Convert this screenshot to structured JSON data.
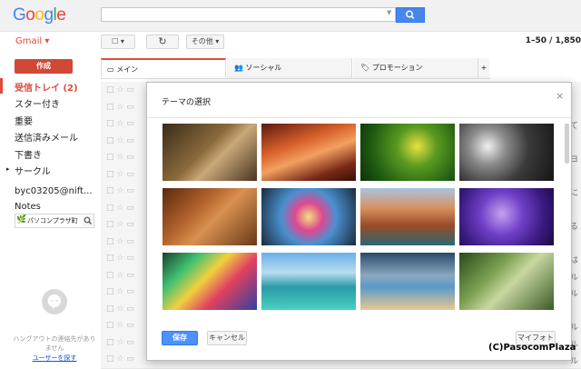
{
  "header": {
    "logo_letters": [
      {
        "ch": "G",
        "color": "#4285f4"
      },
      {
        "ch": "o",
        "color": "#ea4335"
      },
      {
        "ch": "o",
        "color": "#fbbc05"
      },
      {
        "ch": "g",
        "color": "#4285f4"
      },
      {
        "ch": "l",
        "color": "#34a853"
      },
      {
        "ch": "e",
        "color": "#ea4335"
      }
    ],
    "search_placeholder": "",
    "search_icon": "search-icon"
  },
  "toolbar": {
    "gmail_label": "Gmail",
    "select_label": "☐ ▾",
    "refresh_icon": "↻",
    "more_label": "その他 ▾",
    "pagination": "1–50 / 1,850"
  },
  "sidebar": {
    "compose_label": "作成",
    "items": [
      {
        "label": "受信トレイ (2)",
        "active": true
      },
      {
        "label": "スター付き"
      },
      {
        "label": "重要"
      },
      {
        "label": "送信済みメール"
      },
      {
        "label": "下書き"
      },
      {
        "label": "サークル"
      },
      {
        "label": "byc03205@nift..."
      },
      {
        "label": "Notes"
      }
    ],
    "chat_name": "パソコンプラザ町",
    "hangout_text": "ハングアウトの連絡先がありません",
    "hangout_link": "ユーザーを探す"
  },
  "mail_tabs": [
    {
      "label": "メイン",
      "icon": "inbox-icon"
    },
    {
      "label": "ソーシャル",
      "icon": "people-icon"
    },
    {
      "label": "プロモーション",
      "icon": "tag-icon"
    },
    {
      "label": "+"
    }
  ],
  "right_chars": [
    "",
    "",
    "て",
    "",
    "ヨ",
    "",
    "に",
    "",
    "る",
    "",
    "は",
    "ル",
    "ル",
    "",
    "ル",
    "ル",
    "ル"
  ],
  "modal": {
    "title": "テーマの選択",
    "close_label": "×",
    "save_label": "保存",
    "cancel_label": "キャンセル",
    "myphoto_label": "マイフォト",
    "themes": [
      {
        "name": "chess-theme-thumbnail",
        "gradient": "linear-gradient(135deg,#3a2a1a 0%,#8a6a3a 45%,#c9a87a 60%,#4a3420 100%)"
      },
      {
        "name": "canyon-theme-thumbnail",
        "gradient": "linear-gradient(160deg,#5a1a10 0%,#d8602a 35%,#f2a060 55%,#7a2a18 80%,#3a0e08 100%)"
      },
      {
        "name": "caterpillar-theme-thumbnail",
        "gradient": "radial-gradient(circle at 60% 40%,#e8e040 0%,#5a9a20 30%,#1e5a10 70%,#0e3008 100%)"
      },
      {
        "name": "pipes-theme-thumbnail",
        "gradient": "radial-gradient(circle at 30% 40%,#f0f0f0 0%,#8a8a8a 25%,#3a3a3a 55%,#151515 100%)"
      },
      {
        "name": "leaves-theme-thumbnail",
        "gradient": "linear-gradient(135deg,#5a2a10 0%,#b0602a 35%,#d89050 55%,#6a3818 100%)"
      },
      {
        "name": "bokeh-theme-thumbnail",
        "gradient": "radial-gradient(circle at 50% 50%,#f0e080 0%,#e04890 25%,#4a90d0 50%,#1a2a3a 100%)"
      },
      {
        "name": "river-canyon-theme-thumbnail",
        "gradient": "linear-gradient(180deg,#a8c4e0 0%,#d89060 35%,#9a4a28 65%,#2a6a70 100%)"
      },
      {
        "name": "jellyfish-theme-thumbnail",
        "gradient": "radial-gradient(circle at 45% 45%,#c8a0f0 0%,#7040c8 35%,#3a1a80 70%,#1a0a40 100%)"
      },
      {
        "name": "rainbow-theme-thumbnail",
        "gradient": "linear-gradient(135deg,#1a4030 0%,#40c070 25%,#f0d040 45%,#e04060 65%,#3040a0 100%)"
      },
      {
        "name": "lake-theme-thumbnail",
        "gradient": "linear-gradient(180deg,#6ab0e8 0%,#b8dcf0 35%,#2a9aa8 60%,#4ad0c0 100%)"
      },
      {
        "name": "beach-theme-thumbnail",
        "gradient": "linear-gradient(180deg,#2a4a6a 0%,#8aa8c0 40%,#5a9ac8 60%,#e8c890 100%)"
      },
      {
        "name": "forest-theme-thumbnail",
        "gradient": "linear-gradient(135deg,#2a4a1a 0%,#7aa050 35%,#c8d8a0 55%,#3a5a28 100%)"
      }
    ]
  },
  "watermark": "(C)PasocomPlaza"
}
